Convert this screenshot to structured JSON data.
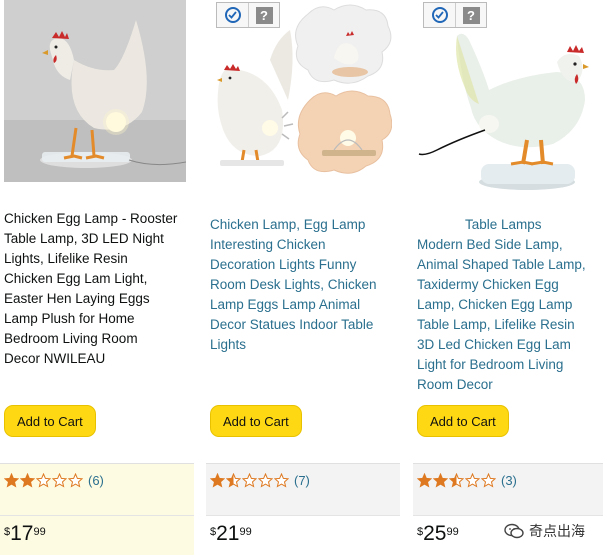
{
  "products": [
    {
      "title_lines": [
        "Chicken Egg Lamp - Rooster",
        "Table Lamp, 3D LED Night",
        "Lights, Lifelike Resin",
        "Chicken Egg Lam Light,",
        "Easter Hen Laying Eggs",
        "Lamp Plush for Home",
        "Bedroom Living Room",
        "Decor NWILEAU"
      ],
      "cart_label": "Add to Cart",
      "rating_value": 2,
      "rating_count": "(6)",
      "price_symbol": "$",
      "price_whole": "17",
      "price_fraction": "99"
    },
    {
      "title_lines": [
        "Chicken Lamp, Egg Lamp",
        "Interesting Chicken",
        "Decoration Lights Funny",
        "Room Desk Lights, Chicken",
        "Lamp Eggs Lamp Animal",
        "Decor Statues Indoor Table",
        "Lights"
      ],
      "cart_label": "Add to Cart",
      "rating_value": 1.5,
      "rating_count": "(7)",
      "price_symbol": "$",
      "price_whole": "21",
      "price_fraction": "99"
    },
    {
      "title_lines": [
        "Table Lamps",
        "Modern Bed Side Lamp,",
        "Animal Shaped Table Lamp,",
        "Taxidermy Chicken Egg",
        "Lamp, Chicken Egg Lamp",
        "Table Lamp, Lifelike Resin",
        "3D Led Chicken Egg Lam",
        "Light for Bedroom Living",
        "Room Decor"
      ],
      "cart_label": "Add to Cart",
      "rating_value": 2.5,
      "rating_count": "(3)",
      "price_symbol": "$",
      "price_whole": "25",
      "price_fraction": "99"
    }
  ],
  "badges": {
    "check_icon": "check-circle-icon",
    "help_label": "?"
  },
  "watermark": {
    "text": "奇点出海"
  },
  "colors": {
    "star": "#de7921",
    "cart": "#ffd814",
    "link": "#2a6f8e"
  }
}
